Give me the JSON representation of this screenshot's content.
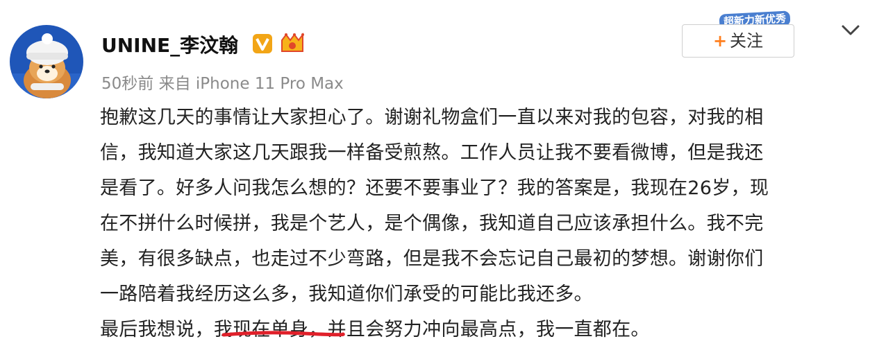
{
  "post": {
    "username": "UNINE_李汶翰",
    "verified_badge": "V",
    "level_badge": "lv",
    "meta": "50秒前 来自 iPhone 11 Pro Max",
    "follow_label": "关注",
    "stamp_text": "超新力新优秀",
    "content_lines": [
      "抱歉这几天的事情让大家担心了。谢谢礼物盒们一直以来对我的包容，对我的相",
      "信，我知道大家这几天跟我一样备受煎熬。工作人员让我不要看微博，但是我还",
      "是看了。好多人问我怎么想的？还要不要事业了？我的答案是，我现在26岁，现",
      "在不拼什么时候拼，我是个艺人，是个偶像，我知道自己应该承担什么。我不完",
      "美，有很多缺点，也走过不少弯路，但是我不会忘记自己最初的梦想。谢谢你们",
      "一路陪着我经历这么多，我知道你们承受的可能比我还多。"
    ],
    "last_line": {
      "before": "最后我想说，",
      "highlighted": "我现在单身",
      "after": "，并且会努力冲向最高点，我一直都在。"
    }
  },
  "colors": {
    "accent_orange": "#ff7f1e",
    "underline_red": "#e0202a",
    "meta_gray": "#8a8a8a",
    "verified_gold": "#f2a516"
  },
  "icons": {
    "avatar": "shiba-dog-in-white-hat",
    "verified": "verified-v-icon",
    "level": "crown-level-icon",
    "menu": "chevron-down-icon"
  }
}
